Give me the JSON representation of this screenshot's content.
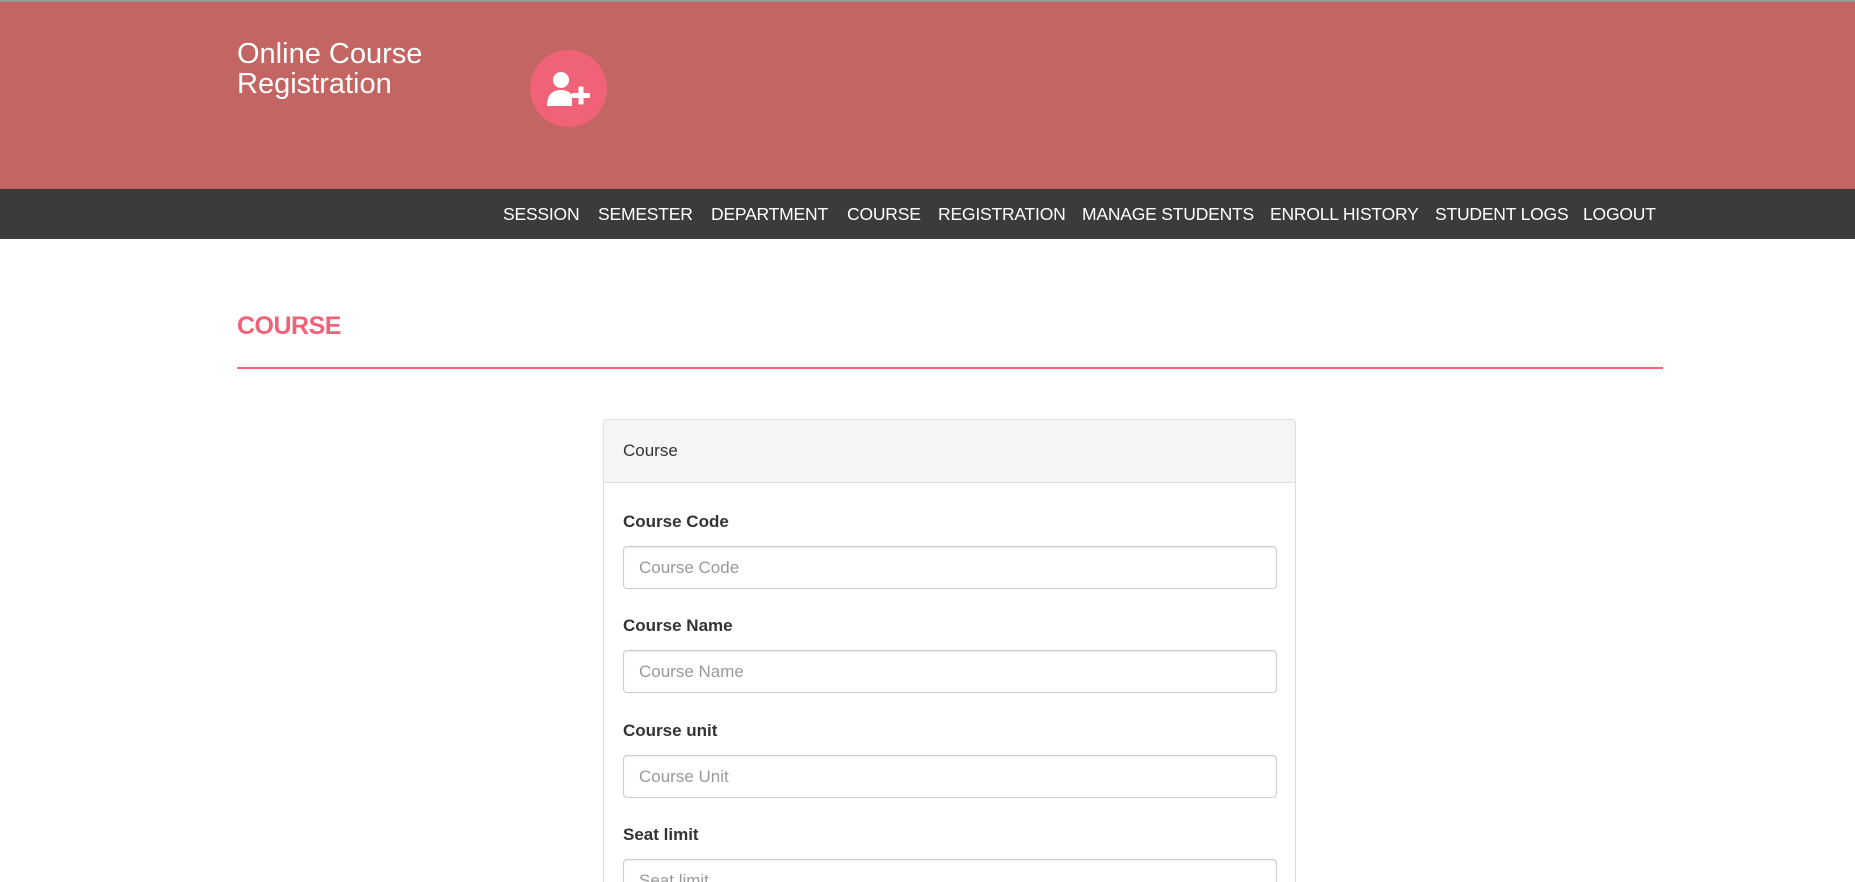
{
  "header": {
    "brand_title": "Online Course Registration",
    "logo_icon": "user-plus-icon",
    "colors": {
      "header_bg": "#c26563",
      "accent": "#ef6278",
      "nav_bg": "#3b3b3b"
    }
  },
  "nav": {
    "items": [
      {
        "label": "SESSION"
      },
      {
        "label": "SEMESTER"
      },
      {
        "label": "DEPARTMENT"
      },
      {
        "label": "COURSE"
      },
      {
        "label": "REGISTRATION"
      },
      {
        "label": "MANAGE STUDENTS"
      },
      {
        "label": "ENROLL HISTORY"
      },
      {
        "label": "STUDENT LOGS"
      },
      {
        "label": "LOGOUT"
      }
    ]
  },
  "page": {
    "title": "COURSE"
  },
  "form": {
    "panel_title": "Course",
    "fields": [
      {
        "label": "Course Code",
        "placeholder": "Course Code",
        "value": ""
      },
      {
        "label": "Course Name",
        "placeholder": "Course Name",
        "value": ""
      },
      {
        "label": "Course unit",
        "placeholder": "Course Unit",
        "value": ""
      },
      {
        "label": "Seat limit",
        "placeholder": "Seat limit",
        "value": ""
      }
    ]
  }
}
